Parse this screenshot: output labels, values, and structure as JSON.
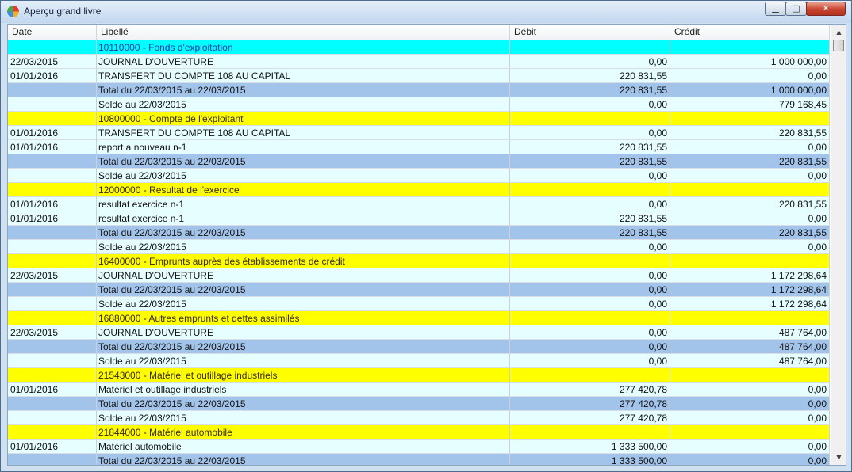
{
  "window": {
    "title": "Aperçu grand livre",
    "minimize_label": "▁",
    "maximize_label": "□",
    "close_label": "✕"
  },
  "columns": {
    "date": "Date",
    "libelle": "Libellé",
    "debit": "Débit",
    "credit": "Crédit"
  },
  "rows": [
    {
      "kind": "account-cyan",
      "date": "",
      "libelle": "10110000 - Fonds d'exploitation",
      "debit": "",
      "credit": ""
    },
    {
      "kind": "entry",
      "date": "22/03/2015",
      "libelle": "JOURNAL D'OUVERTURE",
      "debit": "0,00",
      "credit": "1 000 000,00"
    },
    {
      "kind": "entry",
      "date": "01/01/2016",
      "libelle": "TRANSFERT DU COMPTE 108 AU CAPITAL",
      "debit": "220 831,55",
      "credit": "0,00"
    },
    {
      "kind": "total",
      "date": "",
      "libelle": "Total du 22/03/2015 au 22/03/2015",
      "debit": "220 831,55",
      "credit": "1 000 000,00"
    },
    {
      "kind": "solde",
      "date": "",
      "libelle": "Solde au 22/03/2015",
      "debit": "0,00",
      "credit": "779 168,45"
    },
    {
      "kind": "account",
      "date": "",
      "libelle": "10800000 - Compte de l'exploitant",
      "debit": "",
      "credit": ""
    },
    {
      "kind": "entry",
      "date": "01/01/2016",
      "libelle": "TRANSFERT DU COMPTE 108 AU CAPITAL",
      "debit": "0,00",
      "credit": "220 831,55"
    },
    {
      "kind": "entry",
      "date": "01/01/2016",
      "libelle": "report a nouveau  n-1",
      "debit": "220 831,55",
      "credit": "0,00"
    },
    {
      "kind": "total",
      "date": "",
      "libelle": "Total du 22/03/2015 au 22/03/2015",
      "debit": "220 831,55",
      "credit": "220 831,55"
    },
    {
      "kind": "solde",
      "date": "",
      "libelle": "Solde au 22/03/2015",
      "debit": "0,00",
      "credit": "0,00"
    },
    {
      "kind": "account",
      "date": "",
      "libelle": "12000000 - Resultat de l'exercice",
      "debit": "",
      "credit": ""
    },
    {
      "kind": "entry",
      "date": "01/01/2016",
      "libelle": "resultat exercice n-1",
      "debit": "0,00",
      "credit": "220 831,55"
    },
    {
      "kind": "entry",
      "date": "01/01/2016",
      "libelle": "resultat exercice n-1",
      "debit": "220 831,55",
      "credit": "0,00"
    },
    {
      "kind": "total",
      "date": "",
      "libelle": "Total du 22/03/2015 au 22/03/2015",
      "debit": "220 831,55",
      "credit": "220 831,55"
    },
    {
      "kind": "solde",
      "date": "",
      "libelle": "Solde au 22/03/2015",
      "debit": "0,00",
      "credit": "0,00"
    },
    {
      "kind": "account",
      "date": "",
      "libelle": "16400000 - Emprunts auprès des établissements de crédit",
      "debit": "",
      "credit": ""
    },
    {
      "kind": "entry",
      "date": "22/03/2015",
      "libelle": "JOURNAL D'OUVERTURE",
      "debit": "0,00",
      "credit": "1 172 298,64"
    },
    {
      "kind": "total",
      "date": "",
      "libelle": "Total du 22/03/2015 au 22/03/2015",
      "debit": "0,00",
      "credit": "1 172 298,64"
    },
    {
      "kind": "solde",
      "date": "",
      "libelle": "Solde au 22/03/2015",
      "debit": "0,00",
      "credit": "1 172 298,64"
    },
    {
      "kind": "account",
      "date": "",
      "libelle": "16880000 - Autres emprunts et dettes assimilés",
      "debit": "",
      "credit": ""
    },
    {
      "kind": "entry",
      "date": "22/03/2015",
      "libelle": "JOURNAL D'OUVERTURE",
      "debit": "0,00",
      "credit": "487 764,00"
    },
    {
      "kind": "total",
      "date": "",
      "libelle": "Total du 22/03/2015 au 22/03/2015",
      "debit": "0,00",
      "credit": "487 764,00"
    },
    {
      "kind": "solde",
      "date": "",
      "libelle": "Solde au 22/03/2015",
      "debit": "0,00",
      "credit": "487 764,00"
    },
    {
      "kind": "account",
      "date": "",
      "libelle": "21543000 - Matériel et outillage industriels",
      "debit": "",
      "credit": ""
    },
    {
      "kind": "entry",
      "date": "01/01/2016",
      "libelle": "Matériel et outillage industriels",
      "debit": "277 420,78",
      "credit": "0,00"
    },
    {
      "kind": "total",
      "date": "",
      "libelle": "Total du 22/03/2015 au 22/03/2015",
      "debit": "277 420,78",
      "credit": "0,00"
    },
    {
      "kind": "solde",
      "date": "",
      "libelle": "Solde au 22/03/2015",
      "debit": "277 420,78",
      "credit": "0,00"
    },
    {
      "kind": "account",
      "date": "",
      "libelle": "21844000 - Matériel automobile",
      "debit": "",
      "credit": ""
    },
    {
      "kind": "entry",
      "date": "01/01/2016",
      "libelle": "Matériel automobile",
      "debit": "1 333 500,00",
      "credit": "0,00"
    },
    {
      "kind": "total",
      "date": "",
      "libelle": "Total du 22/03/2015 au 22/03/2015",
      "debit": "1 333 500,00",
      "credit": "0,00"
    }
  ],
  "colors": {
    "account_highlight": "#00ffff",
    "account_header": "#ffff00",
    "total_row": "#a3c4ea",
    "entry_row": "#e6feff"
  },
  "icons": {
    "app": "app-icon",
    "scroll_up": "chevron-up-icon",
    "scroll_down": "chevron-down-icon"
  }
}
